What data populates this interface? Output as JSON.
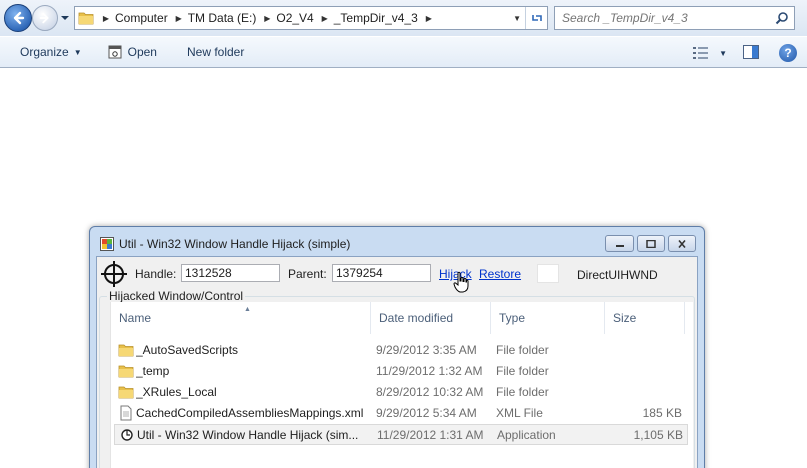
{
  "explorer": {
    "breadcrumbs": [
      "Computer",
      "TM Data (E:)",
      "O2_V4",
      "_TempDir_v4_3"
    ],
    "search_placeholder": "Search _TempDir_v4_3",
    "toolbar": {
      "organize": "Organize",
      "open": "Open",
      "new_folder": "New folder"
    },
    "icons": [
      "back-arrow-icon",
      "forward-arrow-icon",
      "folder-icon",
      "refresh-icon",
      "search-icon",
      "views-icon",
      "preview-pane-icon",
      "help-icon"
    ]
  },
  "dialog": {
    "title": "Util - Win32 Window Handle Hijack (simple)",
    "handle_label": "Handle:",
    "handle_value": "1312528",
    "parent_label": "Parent:",
    "parent_value": "1379254",
    "hijack_link": "Hijack",
    "restore_link": "Restore",
    "window_class": "DirectUIHWND",
    "group_label": "Hijacked Window/Control",
    "columns": {
      "name": "Name",
      "date": "Date modified",
      "type": "Type",
      "size": "Size"
    },
    "files": [
      {
        "name": "_AutoSavedScripts",
        "date": "9/29/2012 3:35 AM",
        "type": "File folder",
        "size": "",
        "icon": "folder-icon"
      },
      {
        "name": "_temp",
        "date": "11/29/2012 1:32 AM",
        "type": "File folder",
        "size": "",
        "icon": "folder-icon"
      },
      {
        "name": "_XRules_Local",
        "date": "8/29/2012 10:32 AM",
        "type": "File folder",
        "size": "",
        "icon": "folder-icon"
      },
      {
        "name": "CachedCompiledAssembliesMappings.xml",
        "date": "9/29/2012 5:34 AM",
        "type": "XML File",
        "size": "185 KB",
        "icon": "xml-file-icon"
      },
      {
        "name": "Util - Win32 Window Handle Hijack (sim...",
        "date": "11/29/2012 1:31 AM",
        "type": "Application",
        "size": "1,105 KB",
        "icon": "application-icon"
      }
    ]
  },
  "colors": {
    "accent": "#1e395b",
    "link": "#0033cc",
    "folder": "#e8c04a"
  }
}
